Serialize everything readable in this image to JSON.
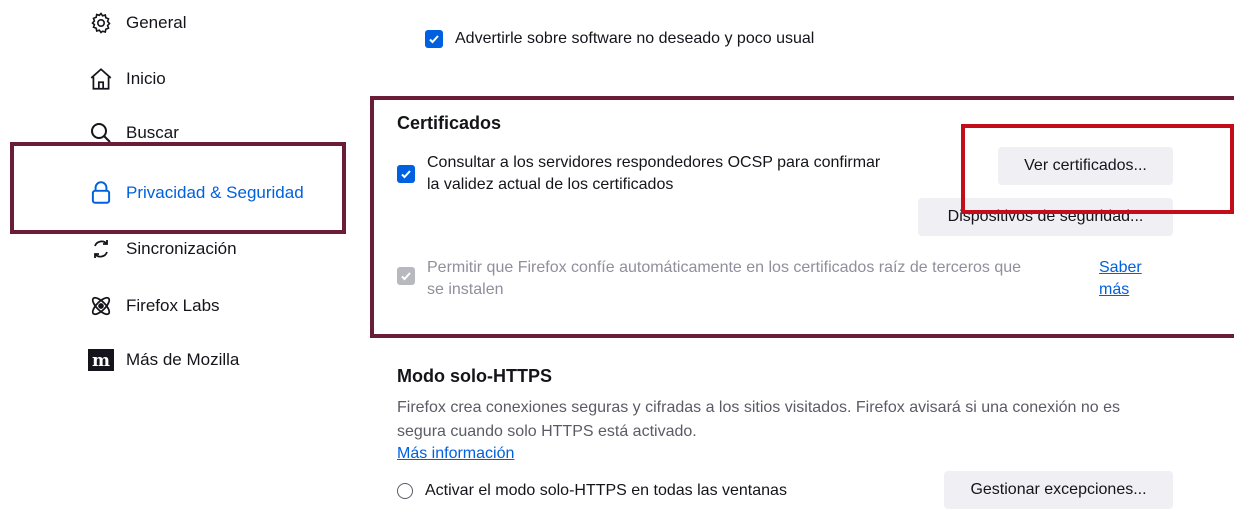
{
  "sidebar": {
    "items": [
      {
        "label": "General",
        "icon": "gear-icon"
      },
      {
        "label": "Inicio",
        "icon": "home-icon"
      },
      {
        "label": "Buscar",
        "icon": "search-icon"
      },
      {
        "label": "Privacidad & Seguridad",
        "icon": "lock-icon",
        "selected": true
      },
      {
        "label": "Sincronización",
        "icon": "sync-icon"
      },
      {
        "label": "Firefox Labs",
        "icon": "labs-icon"
      },
      {
        "label": "Más de Mozilla",
        "icon": "mozilla-icon"
      }
    ]
  },
  "main": {
    "warn_unwanted_label": "Advertirle sobre software no deseado y poco usual",
    "certificates": {
      "title": "Certificados",
      "ocsp_label_line1": "Consultar a los servidores respondedores OCSP para confirmar",
      "ocsp_label_line2": "la validez actual de los certificados",
      "view_certificates_button": "Ver certificados...",
      "security_devices_button": "Dispositivos de seguridad...",
      "third_party_label_line1": "Permitir que Firefox confíe automáticamente en los certificados raíz de terceros que",
      "third_party_label_line2": "se instalen",
      "learn_more_line1": "Saber",
      "learn_more_line2": "más"
    },
    "https_only": {
      "title": "Modo solo-HTTPS",
      "description_line1": "Firefox crea conexiones seguras y cifradas a los sitios visitados. Firefox avisará si una conexión no es",
      "description_line2": "segura cuando solo HTTPS está activado.",
      "more_info": "Más información",
      "enable_all_windows_label": "Activar el modo solo-HTTPS en todas las ventanas",
      "manage_exceptions_button": "Gestionar excepciones..."
    }
  },
  "colors": {
    "accent": "#0061e0",
    "highlight_box": "#6b1d38",
    "red_box": "#c40d1a"
  }
}
